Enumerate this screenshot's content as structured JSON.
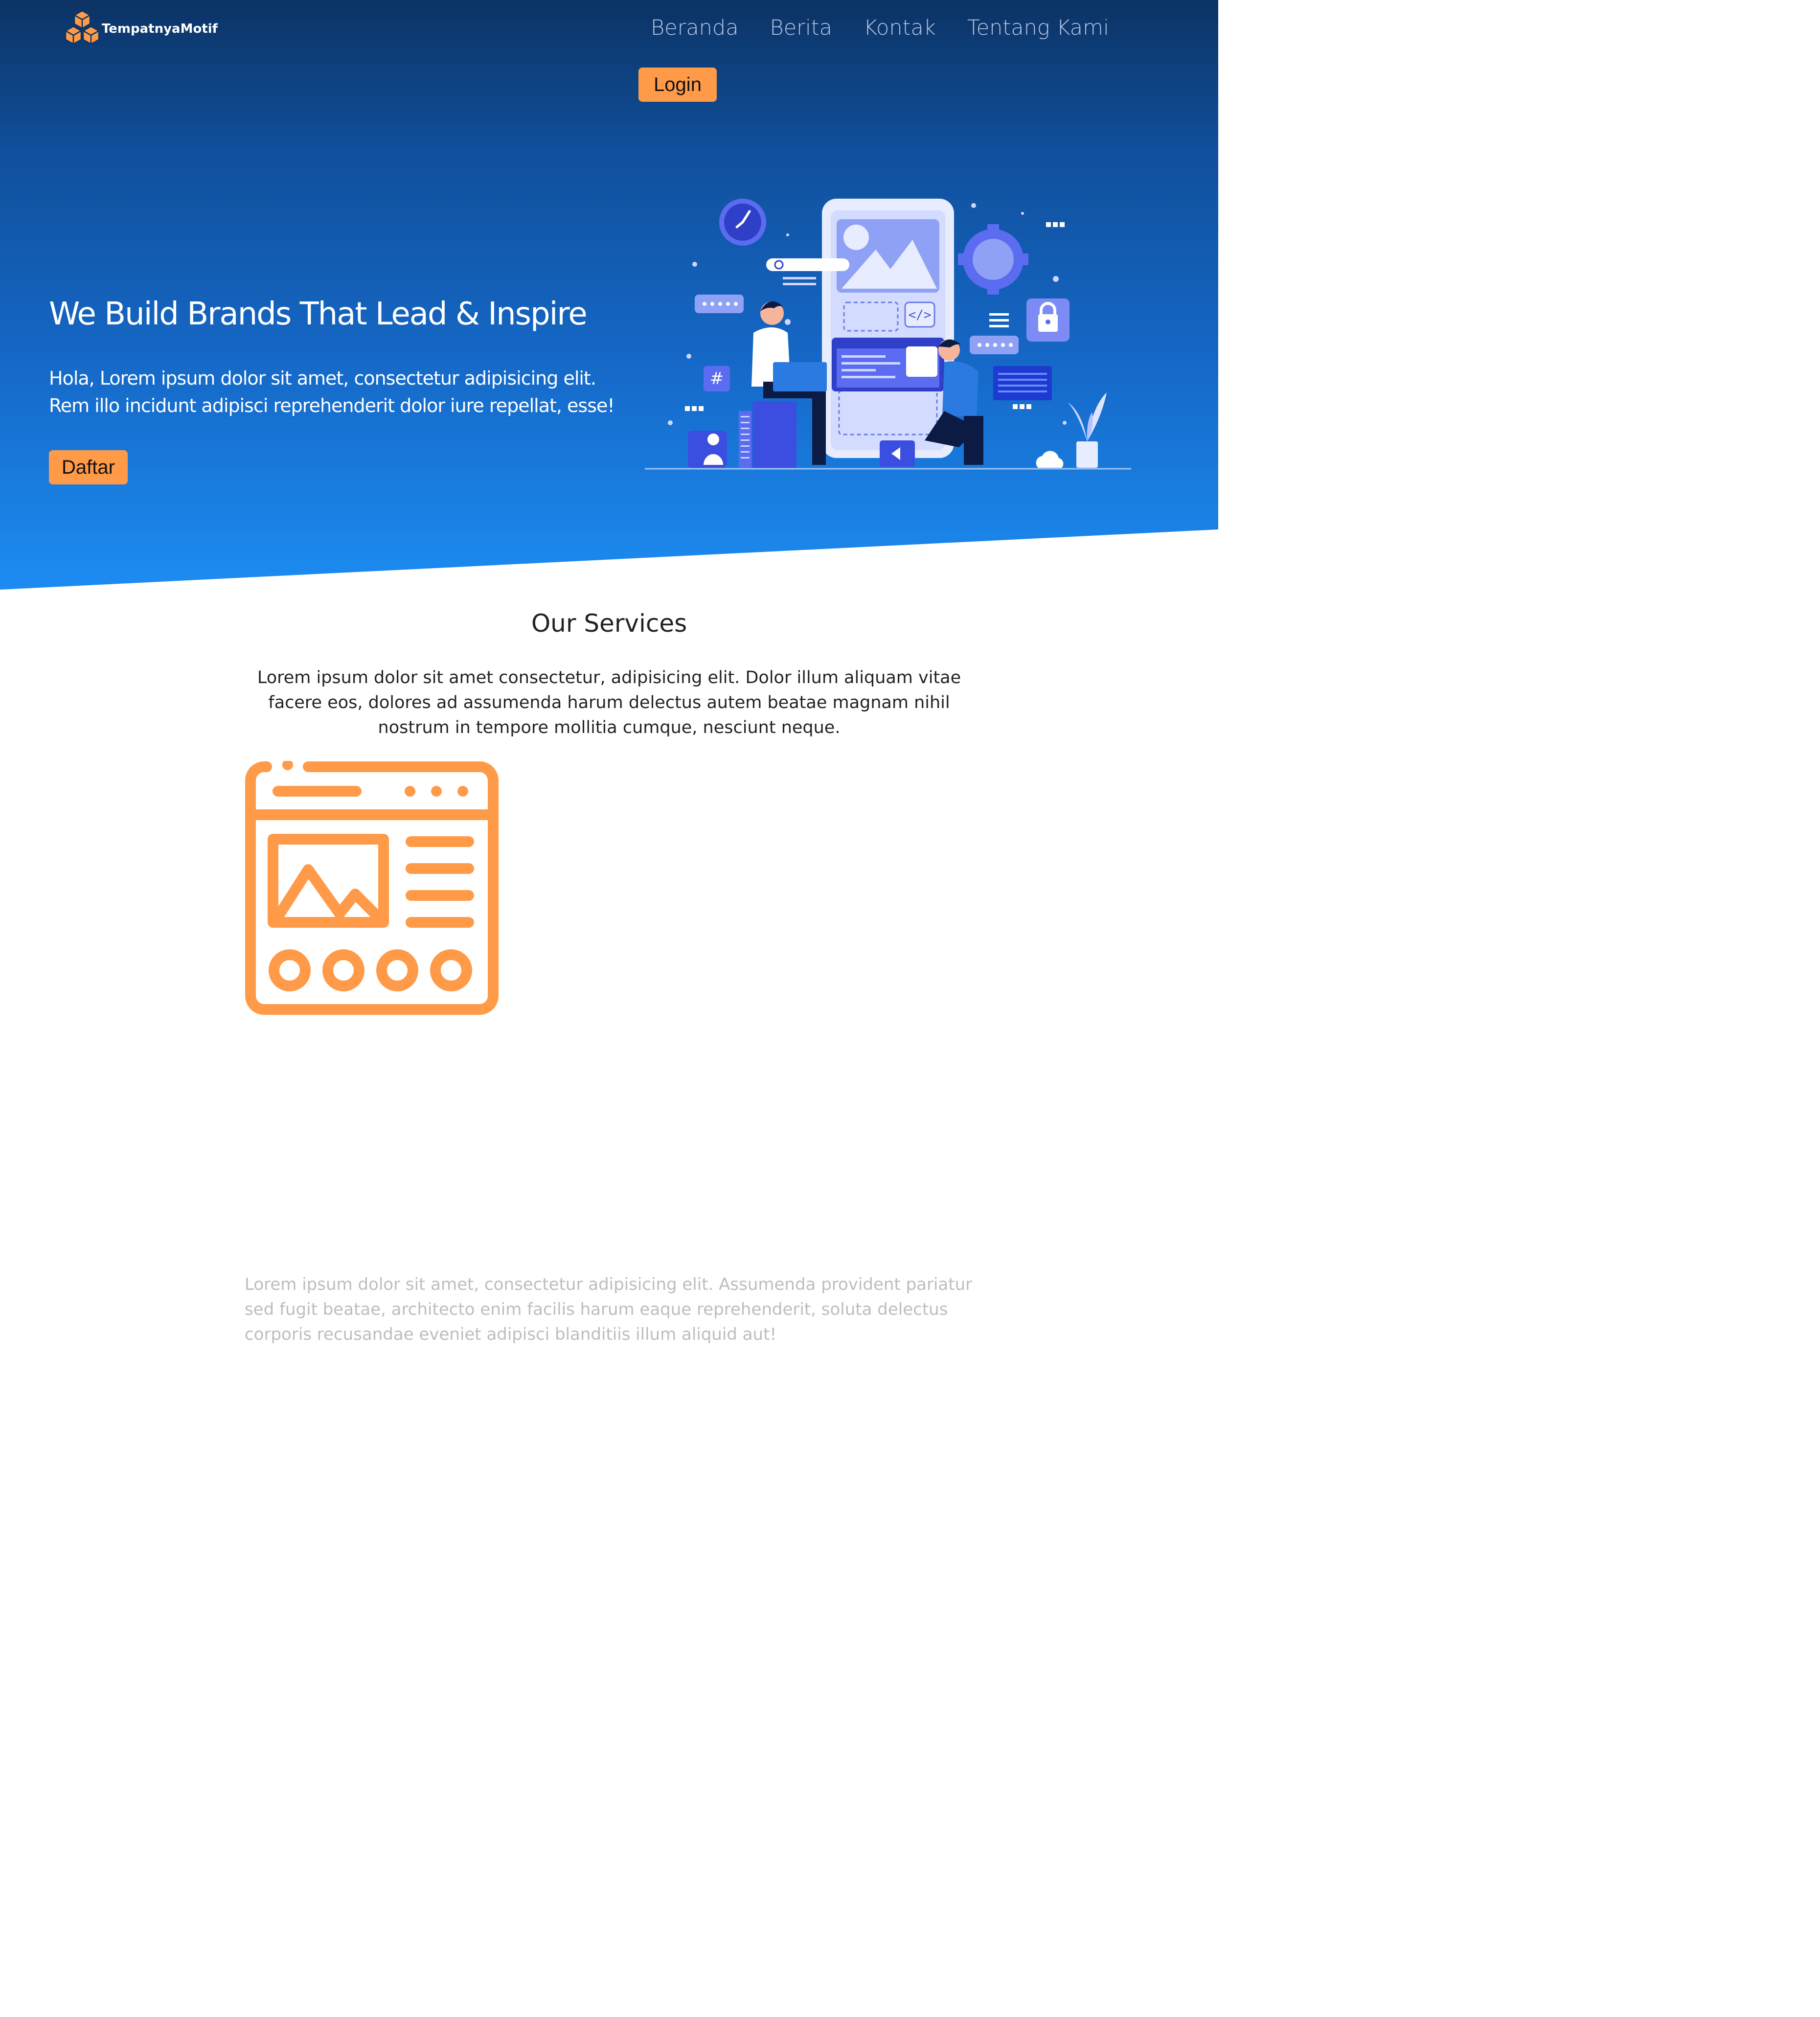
{
  "brand": {
    "name": "TempatnyaMotif",
    "logo_icon": "cubes-logo-icon",
    "accent_color": "#ff9a48"
  },
  "nav": {
    "items": [
      {
        "label": "Beranda"
      },
      {
        "label": "Berita"
      },
      {
        "label": "Kontak"
      },
      {
        "label": "Tentang Kami"
      }
    ],
    "login_label": "Login"
  },
  "hero": {
    "title": "We Build Brands That Lead & Inspire",
    "text_line1": "Hola, Lorem ipsum dolor sit amet, consectetur adipisicing elit.",
    "text_line2": "Rem illo incidunt adipisci reprehenderit dolor iure repellat, esse!",
    "cta_label": "Daftar",
    "illustration": "app-development-illustration",
    "gradient_top": "#0c3364",
    "gradient_bottom": "#1c8cf2"
  },
  "services": {
    "title": "Our Services",
    "description": "Lorem ipsum dolor sit amet consectetur, adipisicing elit. Dolor illum aliquam vitae facere eos, dolores ad assumenda harum delectus autem beatae magnam nihil nostrum in tempore mollitia cumque, nesciunt neque.",
    "icon": "web-layout-icon",
    "item_text": "Lorem ipsum dolor sit amet, consectetur adipisicing elit. Assumenda provident pariatur sed fugit beatae, architecto enim facilis harum eaque reprehenderit, soluta delectus corporis recusandae eveniet adipisci blanditiis illum aliquid aut!"
  }
}
